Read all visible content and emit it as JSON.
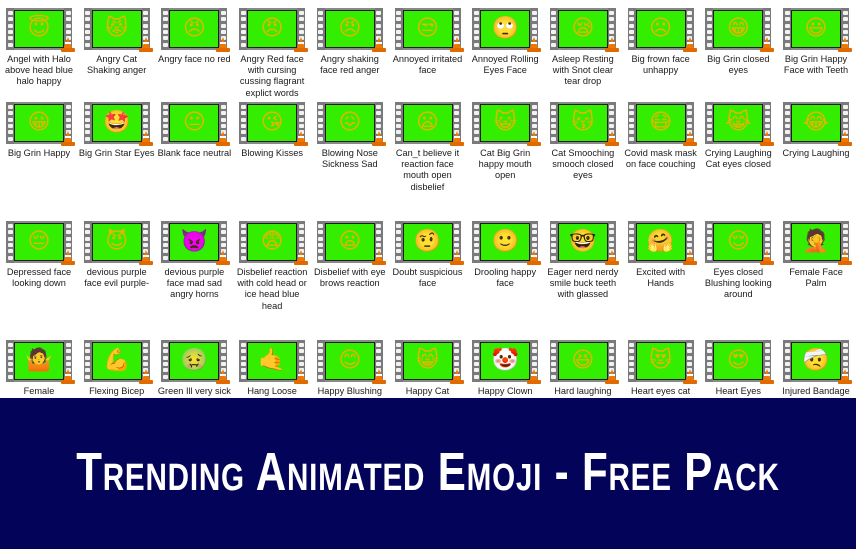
{
  "files": [
    {
      "label": "Angel with Halo above head blue halo happy",
      "icon": "😇"
    },
    {
      "label": "Angry Cat Shaking anger",
      "icon": "😾"
    },
    {
      "label": "Angry face no red",
      "icon": "😠"
    },
    {
      "label": "Angry Red face with cursing cussing flagrant explict words",
      "icon": "😠"
    },
    {
      "label": "Angry shaking face red anger",
      "icon": "😠"
    },
    {
      "label": "Annoyed irritated face",
      "icon": "😒"
    },
    {
      "label": "Annoyed Rolling Eyes Face",
      "icon": "🙄"
    },
    {
      "label": "Asleep Resting with Snot clear tear drop",
      "icon": "😪"
    },
    {
      "label": "Big frown face unhappy",
      "icon": "☹"
    },
    {
      "label": "Big Grin closed eyes",
      "icon": "😁"
    },
    {
      "label": "Big Grin Happy Face with Teeth",
      "icon": "😃"
    },
    {
      "label": "Big Grin Happy",
      "icon": "😀"
    },
    {
      "label": "Big Grin Star Eyes",
      "icon": "🤩"
    },
    {
      "label": "Blank face neutral",
      "icon": "😐"
    },
    {
      "label": "Blowing Kisses",
      "icon": "😘"
    },
    {
      "label": "Blowing Nose Sickness Sad",
      "icon": "😖"
    },
    {
      "label": "Can_t believe it reaction face mouth open disbelief",
      "icon": "😦"
    },
    {
      "label": "Cat Big Grin happy mouth open",
      "icon": "😺"
    },
    {
      "label": "Cat Smooching smooch closed eyes",
      "icon": "😽"
    },
    {
      "label": "Covid mask mask on face couching",
      "icon": "😷"
    },
    {
      "label": "Crying Laughing Cat eyes closed",
      "icon": "😹"
    },
    {
      "label": "Crying Laughing",
      "icon": "😂"
    },
    {
      "label": "Depressed face looking down",
      "icon": "😔"
    },
    {
      "label": "devious purple face evil purple-",
      "icon": "😈"
    },
    {
      "label": "devious purple face mad sad angry horns",
      "icon": "👿"
    },
    {
      "label": "Disbelief reaction with cold head or ice head blue head",
      "icon": "😨"
    },
    {
      "label": "Disbelief with eye brows reaction",
      "icon": "😦"
    },
    {
      "label": "Doubt suspicious face",
      "icon": "🤨"
    },
    {
      "label": "Drooling happy face",
      "icon": "🙂"
    },
    {
      "label": "Eager nerd nerdy smile buck teeth with glassed",
      "icon": "🤓"
    },
    {
      "label": "Excited with Hands",
      "icon": "🤗"
    },
    {
      "label": "Eyes closed Blushing looking around",
      "icon": "😌"
    },
    {
      "label": "Female Face Palm",
      "icon": "🤦"
    },
    {
      "label": "Female",
      "icon": "🤷"
    },
    {
      "label": "Flexing Bicep",
      "icon": "💪"
    },
    {
      "label": "Green Ill very sick",
      "icon": "🤢"
    },
    {
      "label": "Hang Loose",
      "icon": "🤙"
    },
    {
      "label": "Happy Blushing",
      "icon": "😊"
    },
    {
      "label": "Happy Cat",
      "icon": "😸"
    },
    {
      "label": "Happy Clown",
      "icon": "🤡"
    },
    {
      "label": "Hard laughing",
      "icon": "😆"
    },
    {
      "label": "Heart eyes cat",
      "icon": "😻"
    },
    {
      "label": "Heart Eyes",
      "icon": "😍"
    },
    {
      "label": "Injured Bandage",
      "icon": "🤕"
    }
  ],
  "banner": {
    "title": "Trending Animated Emoji - Free Pack"
  },
  "colors": {
    "thumbnail_background": "#33ee00",
    "banner_background": "#03035a",
    "banner_text": "#ffffff",
    "vlc_cone": "#f07800"
  }
}
